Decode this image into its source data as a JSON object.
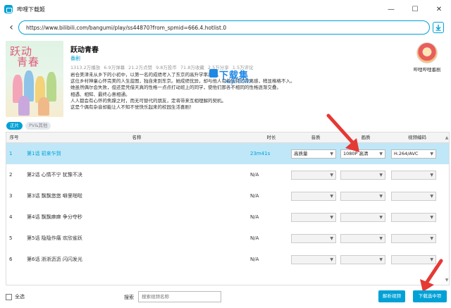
{
  "window": {
    "title": "哔哩下载姬",
    "minimize": "—",
    "maximize": "☐",
    "close": "✕"
  },
  "urlbar": {
    "back": "‹",
    "url": "https://www.bilibili.com/bangumi/play/ss44870?from_spmid=666.4.hotlist.0"
  },
  "watermark": {
    "text": "下载集",
    "sub": "xzji.com"
  },
  "poster": {
    "title_line1": "跃动",
    "title_line2": "青春"
  },
  "season": {
    "title": "跃动青春",
    "type": "番剧",
    "stats": [
      "1313.2万播放",
      "6.9万弹幕",
      "21.2万点赞",
      "9.8万投币",
      "71.8万收藏",
      "2.5万分享",
      "1.5万评论"
    ],
    "description": [
      "岩仓美津未从乡下的小初中，以第一名的成绩考入了东京的高升学率高中。",
      "这位乡村神童心怀完美的人生蓝图，独自来到东京。她成绩优异，却与他人有着独特的距离感，稍显格格不入。",
      "她虽然偶尔会失败，但还是凭借天真的性格一点点打动班上的同学，使他们那各不相同的性格逐渐交叠。",
      "相遇、相知、最终心意相通。",
      "人人都会有心怀的焦躁之时，而无可替代的朋友，定将带来互相理解的契机。",
      "这是个偶有杂音却能让人不知不觉快乐起来的校园生活喜剧！"
    ]
  },
  "uploader": {
    "name": "哔哩哔哩番剧"
  },
  "tabs": [
    {
      "label": "正片",
      "active": true
    },
    {
      "label": "PV&其他",
      "active": false
    }
  ],
  "table": {
    "headers": {
      "index": "序号",
      "name": "名称",
      "duration": "时长",
      "audio": "音质",
      "video": "画质",
      "codec": "视频编码"
    },
    "rows": [
      {
        "index": "1",
        "name": "第1话 初来乍到",
        "duration": "23m41s",
        "audio": "高质量",
        "video": "1080P 高清",
        "codec": "H.264/AVC",
        "selected": true
      },
      {
        "index": "2",
        "name": "第2话 心情不宁 犹豫不决",
        "duration": "N/A",
        "audio": "",
        "video": "",
        "codec": "",
        "selected": false
      },
      {
        "index": "3",
        "name": "第3话 飘飘悠悠 噼里啪啦",
        "duration": "N/A",
        "audio": "",
        "video": "",
        "codec": "",
        "selected": false
      },
      {
        "index": "4",
        "name": "第4话 飘飘麻麻 争分夺秒",
        "duration": "N/A",
        "audio": "",
        "video": "",
        "codec": "",
        "selected": false
      },
      {
        "index": "5",
        "name": "第5话 隐隐作痛 欢欣雀跃",
        "duration": "N/A",
        "audio": "",
        "video": "",
        "codec": "",
        "selected": false
      },
      {
        "index": "6",
        "name": "第6话 淅淅沥沥 闪闪发光",
        "duration": "N/A",
        "audio": "",
        "video": "",
        "codec": "",
        "selected": false
      }
    ]
  },
  "footer": {
    "select_all": "全选",
    "search_label": "搜索",
    "search_placeholder": "搜索视频名称",
    "parse_button": "解析视频",
    "download_button": "下载选中项"
  },
  "colors": {
    "accent": "#00a1d6",
    "selected_row": "#bfe7f8",
    "annotation": "#e53935"
  }
}
